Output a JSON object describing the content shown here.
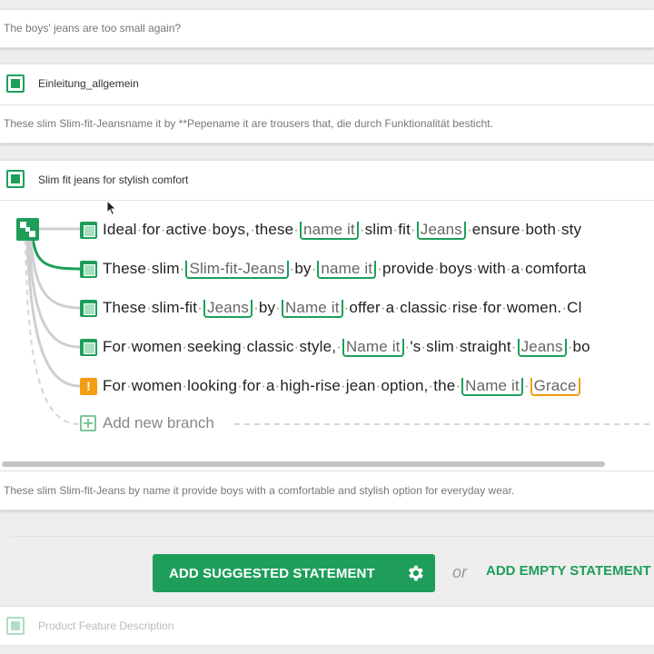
{
  "top_card": {
    "text": "The boys' jeans are too small again?"
  },
  "intro_card": {
    "title": "Einleitung_allgemein",
    "text": "These slim Slim-fit-Jeansname it by **Pepename it are trousers that, die durch Funktionalität besticht."
  },
  "slim_card": {
    "title": "Slim fit jeans for stylish comfort",
    "branches": [
      {
        "status": "ok",
        "segments": [
          {
            "t": "Ideal"
          },
          {
            "t": "for"
          },
          {
            "t": "active"
          },
          {
            "t": "boys,"
          },
          {
            "t": "these"
          },
          {
            "chip": "name it"
          },
          {
            "t": "slim"
          },
          {
            "t": "fit"
          },
          {
            "chip": "Jeans"
          },
          {
            "t": "ensure"
          },
          {
            "t": "both"
          },
          {
            "t": "sty"
          }
        ]
      },
      {
        "status": "ok",
        "segments": [
          {
            "t": "These"
          },
          {
            "t": "slim"
          },
          {
            "chip": "Slim-fit-Jeans"
          },
          {
            "t": "by"
          },
          {
            "chip": "name it"
          },
          {
            "t": "provide"
          },
          {
            "t": "boys"
          },
          {
            "t": "with"
          },
          {
            "t": "a"
          },
          {
            "t": "comforta"
          }
        ]
      },
      {
        "status": "ok",
        "segments": [
          {
            "t": "These"
          },
          {
            "t": "slim-fit"
          },
          {
            "chip": "Jeans"
          },
          {
            "t": "by"
          },
          {
            "chip": "Name it"
          },
          {
            "t": "offer"
          },
          {
            "t": "a"
          },
          {
            "t": "classic"
          },
          {
            "t": "rise"
          },
          {
            "t": "for"
          },
          {
            "t": "women."
          },
          {
            "t": "Cl"
          }
        ]
      },
      {
        "status": "ok",
        "segments": [
          {
            "t": "For"
          },
          {
            "t": "women"
          },
          {
            "t": "seeking"
          },
          {
            "t": "classic"
          },
          {
            "t": "style,"
          },
          {
            "chip": "Name it"
          },
          {
            "t": "'s"
          },
          {
            "t": "slim"
          },
          {
            "t": "straight"
          },
          {
            "chip": "Jeans"
          },
          {
            "t": "bo"
          }
        ]
      },
      {
        "status": "warn",
        "segments": [
          {
            "t": "For"
          },
          {
            "t": "women"
          },
          {
            "t": "looking"
          },
          {
            "t": "for"
          },
          {
            "t": "a"
          },
          {
            "t": "high-rise"
          },
          {
            "t": "jean"
          },
          {
            "t": "option,"
          },
          {
            "t": "the"
          },
          {
            "chip": "Name it"
          },
          {
            "chip": "Grace",
            "color": "orange"
          }
        ]
      }
    ],
    "add_branch_label": "Add new branch",
    "selected_text": "These slim Slim-fit-Jeans by name it provide boys with a comfortable and stylish option for everyday wear."
  },
  "actions": {
    "add_suggested_label": "ADD SUGGESTED STATEMENT",
    "or_label": "or",
    "add_empty_label": "ADD EMPTY STATEMENT"
  },
  "next_card": {
    "title": "Product Feature Description"
  },
  "colors": {
    "accent": "#1e9e5a",
    "warning": "#f29d12"
  },
  "icons": {
    "branch_warning": "!",
    "warning": "warning-icon",
    "check": "checkbox-icon",
    "dice": "dice-icon",
    "settings": "gear-icon",
    "add": "plus-icon"
  }
}
